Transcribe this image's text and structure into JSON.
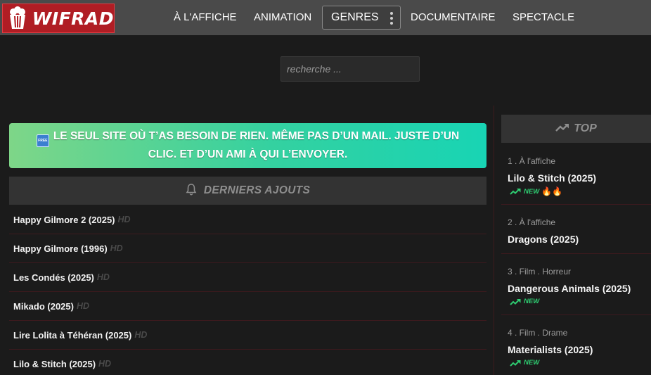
{
  "brand": {
    "name": "WIFRAD",
    "icon": "popcorn-icon"
  },
  "nav": {
    "items": [
      "À L'AFFICHE",
      "ANIMATION",
      "DOCUMENTAIRE",
      "SPECTACLE"
    ],
    "genres_label": "GENRES"
  },
  "search": {
    "placeholder": "recherche ..."
  },
  "banner": {
    "badge": "FREE",
    "text": "LE SEUL SITE OÙ T’AS BESOIN DE RIEN. MÊME PAS D’UN MAIL. JUSTE D’UN CLIC. ET D’UN AMI À QUI L’ENVOYER."
  },
  "latest": {
    "title": "DERNIERS AJOUTS",
    "quality_label": "HD",
    "items": [
      "Happy Gilmore 2 (2025)",
      "Happy Gilmore (1996)",
      "Les Condés (2025)",
      "Mikado (2025)",
      "Lire Lolita à Téhéran (2025)",
      "Lilo & Stitch (2025)"
    ]
  },
  "top": {
    "title": "TOP",
    "new_label": "NEW",
    "items": [
      {
        "meta": "1 . À l'affiche",
        "name": "Lilo & Stitch (2025)",
        "new": true,
        "fire": "🔥🔥"
      },
      {
        "meta": "2 . À l'affiche",
        "name": "Dragons (2025)",
        "new": false,
        "fire": ""
      },
      {
        "meta": "3 . Film . Horreur",
        "name": "Dangerous Animals (2025)",
        "new": true,
        "fire": ""
      },
      {
        "meta": "4 . Film . Drame",
        "name": "Materialists (2025)",
        "new": true,
        "fire": ""
      }
    ]
  },
  "colors": {
    "logo_bg": "#b01d24",
    "nav_bg": "#4a4a4a",
    "page_bg": "#1b1b1b",
    "banner_start": "#7ed688",
    "banner_end": "#18d4b4",
    "new_green": "#2ecc71"
  }
}
